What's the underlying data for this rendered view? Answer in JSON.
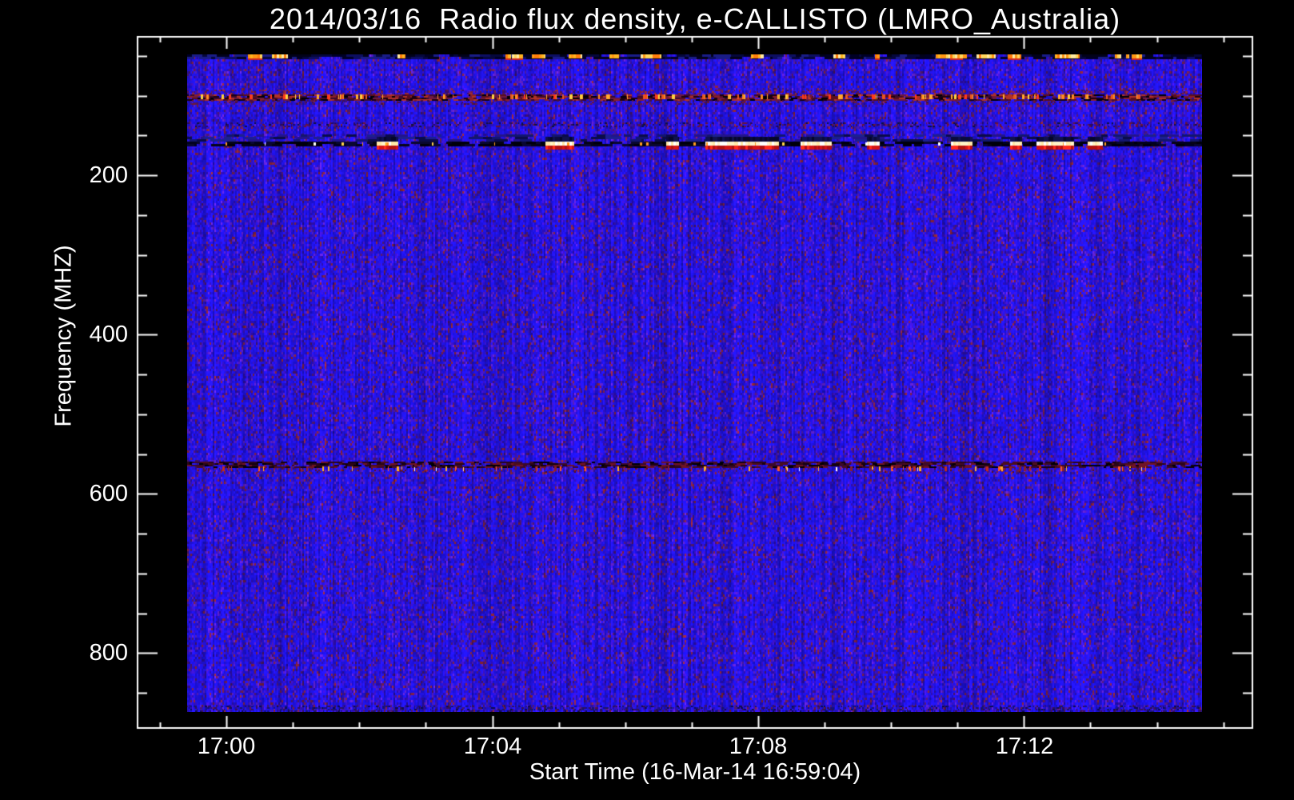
{
  "chart_data": {
    "type": "heatmap",
    "kind": "radio-spectrogram",
    "title": "2014/03/16  Radio flux density, e-CALLISTO (LMRO_Australia)",
    "xlabel": "Start Time (16-Mar-14 16:59:04)",
    "ylabel": "Frequency (MHZ)",
    "x_axis": {
      "unit": "time",
      "tick_labels": [
        "17:00",
        "17:04",
        "17:08",
        "17:12"
      ],
      "major_tick_minutes": [
        0,
        4,
        8,
        12
      ],
      "minor_step_minutes": 1,
      "range_minutes": [
        -1.35,
        15.45
      ],
      "grid": false
    },
    "y_axis": {
      "unit": "MHz",
      "tick_labels": [
        "200",
        "400",
        "600",
        "800"
      ],
      "major_ticks_mhz": [
        200,
        400,
        600,
        800
      ],
      "minor_step_mhz": 50,
      "range_mhz": [
        25,
        895
      ],
      "inverted": true,
      "grid": false
    },
    "data_extent": {
      "time_min_minutes": -0.58,
      "time_max_minutes": 14.68,
      "freq_min_mhz": 48,
      "freq_max_mhz": 874
    },
    "colors": {
      "background": "#000000",
      "frame": "#ffffff",
      "text": "#ffffff",
      "base_blue": "#2214ee"
    },
    "noise_palette": [
      {
        "c": "#2214ee",
        "w": 0.4
      },
      {
        "c": "#1b10d6",
        "w": 0.2
      },
      {
        "c": "#3d12cf",
        "w": 0.14
      },
      {
        "c": "#2b0da8",
        "w": 0.1
      },
      {
        "c": "#5a1fc4",
        "w": 0.07
      },
      {
        "c": "#4a1668",
        "w": 0.045
      },
      {
        "c": "#7c2040",
        "w": 0.03
      },
      {
        "c": "#8c2430",
        "w": 0.015
      }
    ],
    "seed": 1337,
    "interference_bands": [
      {
        "name": "rfi-band-50mhz",
        "freq_mhz": 50,
        "layers": [
          {
            "type": "dashes",
            "dy": [
              -2,
              4
            ],
            "coverage": 0.88,
            "dash": [
              3,
              16
            ],
            "rowStep": 3,
            "palette": [
              "#000026",
              "#05073c",
              "#0c0e60",
              "#191c86",
              "#02021a"
            ]
          },
          {
            "type": "blobs",
            "count": 26,
            "w": [
              4,
              26
            ],
            "xbias": 0.7,
            "stack": [
              {
                "dy": [
                  -2,
                  3
                ],
                "palette": [
                  "#ffb41e",
                  "#ffd75a",
                  "#ff9712",
                  "#ffe9a0",
                  "#ff7d0a"
                ],
                "prob": 1
              },
              {
                "dy": [
                  3,
                  5
                ],
                "palette": [
                  "#d2281e"
                ],
                "prob": 0.35
              }
            ]
          }
        ]
      },
      {
        "name": "fm-band-101mhz",
        "freq_mhz": 101,
        "layers": [
          {
            "type": "specks",
            "dy": [
              -9,
              -3
            ],
            "coverage": 0.28,
            "w": [
              1,
              3
            ],
            "palette": [
              "#7c1f3c",
              "#9c2a34",
              "#5a1450",
              "#3a0f68"
            ]
          },
          {
            "type": "dashes",
            "dy": [
              -3,
              4
            ],
            "coverage": 0.8,
            "dash": [
              2,
              9
            ],
            "rowStep": 2,
            "palette": [
              "#1c0110",
              "#000006",
              "#8c1f26",
              "#b03126",
              "#5a0f1e",
              "#3a0a2e",
              "#6e1a40"
            ]
          },
          {
            "type": "blobs",
            "count": 110,
            "w": [
              1,
              4
            ],
            "xbias": 1,
            "stack": [
              {
                "dy": [
                  -3,
                  3
                ],
                "palette": [
                  "#ff8c1e",
                  "#ffd23e",
                  "#ff3a1a",
                  "#e8581e",
                  "#ffaa2e"
                ],
                "prob": 1
              }
            ]
          },
          {
            "type": "specks",
            "dy": [
              4,
              9
            ],
            "coverage": 0.16,
            "w": [
              1,
              3
            ],
            "palette": [
              "#6e1a34",
              "#4a1040"
            ]
          }
        ]
      },
      {
        "name": "faint-band-137mhz",
        "freq_mhz": 137,
        "layers": [
          {
            "type": "specks",
            "dy": [
              -3,
              3
            ],
            "coverage": 0.22,
            "w": [
              1,
              3
            ],
            "palette": [
              "#6a1438",
              "#2a0a60",
              "#101040"
            ]
          }
        ]
      },
      {
        "name": "vhf-band-163mhz",
        "freq_mhz": 163,
        "layers": [
          {
            "type": "dashes",
            "dy": [
              -14,
              -5
            ],
            "coverage": 0.45,
            "dash": [
              3,
              18
            ],
            "rowStep": 3,
            "palette": [
              "#131670",
              "#0a0c4a",
              "#1c2090",
              "#23148c"
            ]
          },
          {
            "type": "dashes",
            "dy": [
              -5,
              1
            ],
            "coverage": 0.82,
            "dash": [
              3,
              14
            ],
            "rowStep": 3,
            "palette": [
              "#00000a",
              "#02021e",
              "#060414",
              "#0a0830"
            ]
          },
          {
            "type": "blobs",
            "count": 16,
            "w": [
              12,
              46
            ],
            "xbias": 0.75,
            "stack": [
              {
                "dy": [
                  -11,
                  -5
                ],
                "palette": [
                  "#0a0b3c",
                  "#05062a",
                  "#10124e"
                ],
                "prob": 1
              },
              {
                "dy": [
                  -5,
                  0
                ],
                "palette": [
                  "#ffffff",
                  "#fff3c8",
                  "#ffe9a8"
                ],
                "prob": 1
              },
              {
                "dy": [
                  0,
                  5
                ],
                "palette": [
                  "#d51414",
                  "#b30f0f",
                  "#ff2a1a"
                ],
                "prob": 1
              }
            ]
          },
          {
            "type": "blobs",
            "count": 22,
            "w": [
              1,
              3
            ],
            "xbias": 1,
            "stack": [
              {
                "dy": [
                  -4,
                  0
                ],
                "palette": [
                  "#ffffff",
                  "#ffd24a",
                  "#ff9a1e"
                ],
                "prob": 1
              }
            ]
          }
        ]
      },
      {
        "name": "rfi-band-566mhz",
        "freq_mhz": 566,
        "layers": [
          {
            "type": "dashes",
            "dy": [
              -7,
              1
            ],
            "coverage": 0.72,
            "dash": [
              2,
              10
            ],
            "rowStep": 2,
            "palette": [
              "#16020e",
              "#000004",
              "#4c0e1c",
              "#701425",
              "#2a0618",
              "#3c0a2a"
            ]
          },
          {
            "type": "blobs",
            "count": 70,
            "w": [
              1,
              3
            ],
            "xbias": 1,
            "stack": [
              {
                "dy": [
                  -1,
                  5
                ],
                "palette": [
                  "#c22a1e",
                  "#ff5a2a",
                  "#ffb02a",
                  "#8a1f2a"
                ],
                "prob": 1
              }
            ]
          },
          {
            "type": "blobs",
            "count": 8,
            "w": [
              1,
              2
            ],
            "xbias": 1,
            "stack": [
              {
                "dy": [
                  0,
                  5
                ],
                "palette": [
                  "#ffffff",
                  "#ffe9a0"
                ],
                "prob": 1
              }
            ]
          },
          {
            "type": "specks",
            "dy": [
              1,
              7
            ],
            "coverage": 0.12,
            "w": [
              1,
              2
            ],
            "palette": [
              "#8a1f2a",
              "#5a1020"
            ]
          }
        ]
      },
      {
        "name": "bottom-edge-shade",
        "freq_mhz": 862,
        "layers": [
          {
            "type": "specks",
            "dy": [
              4,
              14
            ],
            "coverage": 0.3,
            "w": [
              1,
              3
            ],
            "palette": [
              "#0d0a50",
              "#1a1468",
              "#3a0f50",
              "#151080"
            ]
          }
        ]
      }
    ]
  }
}
